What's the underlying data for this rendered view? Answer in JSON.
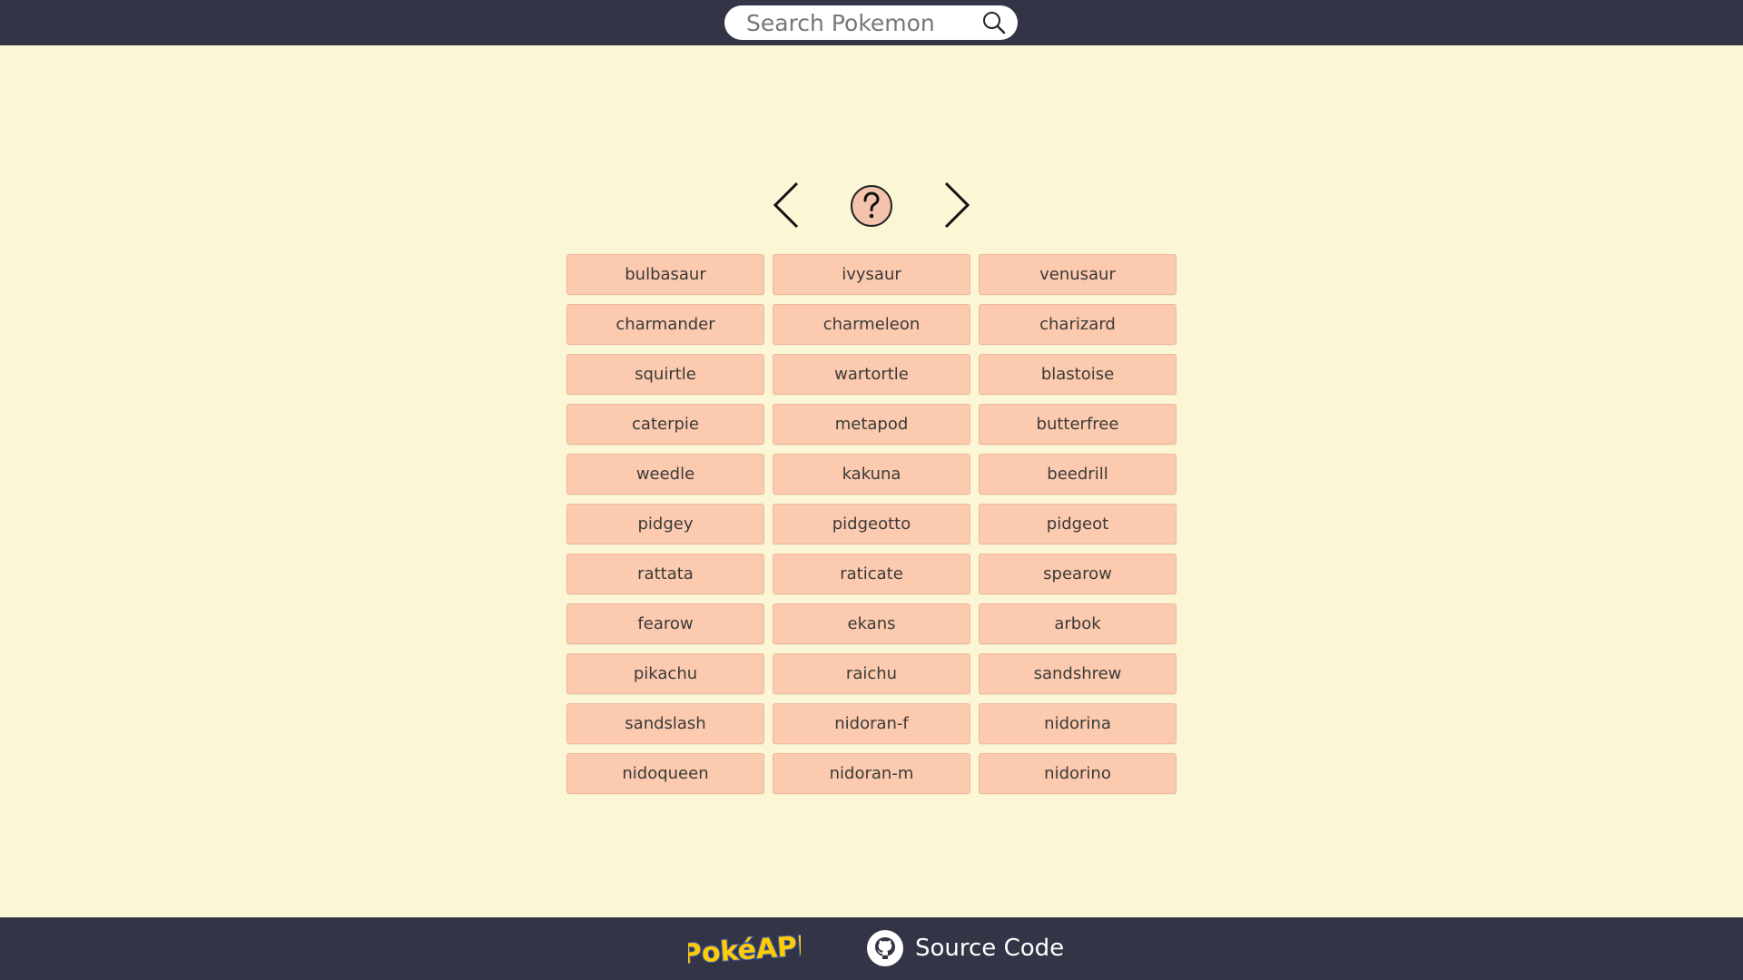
{
  "header": {
    "search": {
      "placeholder": "Search Pokemon",
      "value": "",
      "icon": "search-icon"
    }
  },
  "navigation": {
    "prev_icon": "chevron-left-icon",
    "random_icon": "question-mark-icon",
    "next_icon": "chevron-right-icon"
  },
  "pokemon_list": [
    "bulbasaur",
    "ivysaur",
    "venusaur",
    "charmander",
    "charmeleon",
    "charizard",
    "squirtle",
    "wartortle",
    "blastoise",
    "caterpie",
    "metapod",
    "butterfree",
    "weedle",
    "kakuna",
    "beedrill",
    "pidgey",
    "pidgeotto",
    "pidgeot",
    "rattata",
    "raticate",
    "spearow",
    "fearow",
    "ekans",
    "arbok",
    "pikachu",
    "raichu",
    "sandshrew",
    "sandslash",
    "nidoran-f",
    "nidorina",
    "nidoqueen",
    "nidoran-m",
    "nidorino"
  ],
  "footer": {
    "logo_text": "PokéAPI",
    "source_label": "Source Code",
    "source_icon": "github-icon"
  },
  "colors": {
    "header_bg": "#333446",
    "page_bg": "#fbf7d6",
    "button_bg": "#fccaae",
    "logo_yellow": "#ffcb05",
    "logo_outline": "#3b5ba7"
  }
}
